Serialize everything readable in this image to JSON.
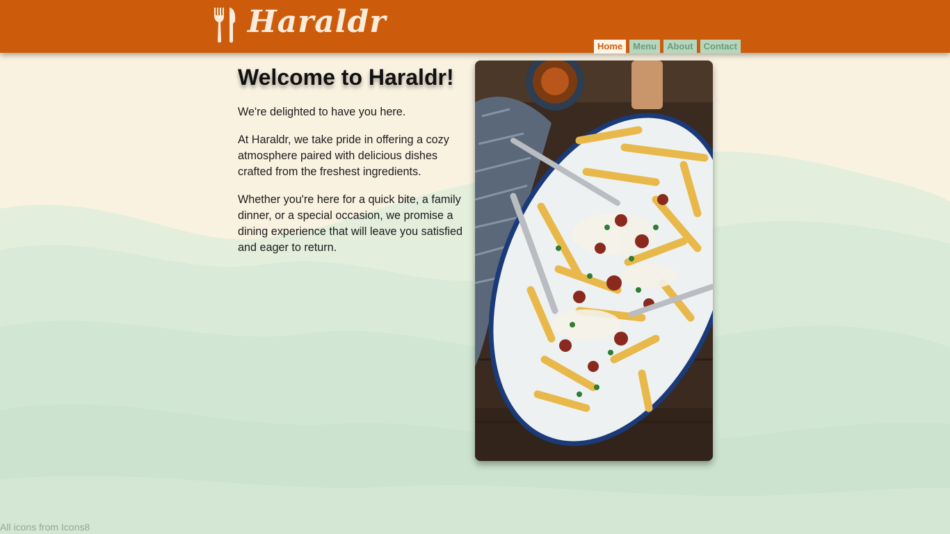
{
  "brand": {
    "name": "Haraldr",
    "logo_icon": "fork-knife-icon",
    "color": "#cc5c0b"
  },
  "nav": {
    "items": [
      {
        "label": "Home",
        "active": true
      },
      {
        "label": "Menu",
        "active": false
      },
      {
        "label": "About",
        "active": false
      },
      {
        "label": "Contact",
        "active": false
      }
    ]
  },
  "main": {
    "title": "Welcome to Haraldr!",
    "paragraphs": [
      "We're delighted to have you here.",
      "At Haraldr, we take pride in offering a cozy atmosphere paired with delicious dishes crafted from the freshest ingredients.",
      "Whether you're here for a quick bite, a family dinner, or a special occasion, we promise a dining experience that will leave you satisfied and eager to return."
    ],
    "image_subject": "plate of loaded fries"
  },
  "footer": {
    "credit": "All icons from Icons8"
  },
  "colors": {
    "header": "#cc5c0b",
    "background": "#faf2e1",
    "hills": "#d5e8d6",
    "nav_inactive_bg": "#b7d6bd",
    "nav_inactive_text": "#6c9b7c",
    "nav_active_bg": "#fdf5e8"
  }
}
